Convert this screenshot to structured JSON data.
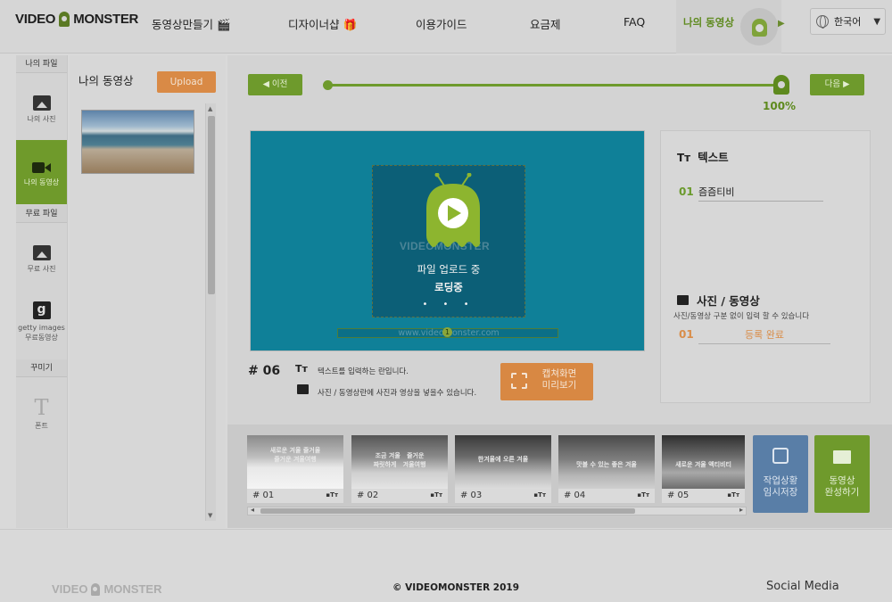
{
  "header": {
    "logo_left": "VIDEO",
    "logo_right": "MONSTER",
    "nav": [
      {
        "label": "동영상만들기 🎬"
      },
      {
        "label": "디자이너샵 🎁"
      },
      {
        "label": "이용가이드"
      },
      {
        "label": "요금제"
      },
      {
        "label": "FAQ"
      }
    ],
    "my_video": "나의 동영상",
    "language": "한국어"
  },
  "sidebar": {
    "my_files": "나의 파일",
    "my_photos": "나의 사진",
    "my_videos": "나의 동영상",
    "free_files": "무료 파일",
    "free_photos": "무료 사진",
    "getty_line1": "getty images",
    "getty_line2": "무료동영상",
    "decorate": "꾸미기",
    "font": "폰트"
  },
  "file_panel": {
    "title": "나의 동영상",
    "upload_label": "Upload"
  },
  "progress": {
    "prev_label": "◀ 이전",
    "next_label": "다음 ▶",
    "percent_text": "100%",
    "value": 1.0
  },
  "preview": {
    "watermark_logo": "VIDEOMONSTER",
    "uploading_text": "파일 업로드 중",
    "loading_text": "로딩중",
    "dots": "• • •",
    "watermark_url": "www.videomonster.com",
    "pin_number": "1"
  },
  "scene_info": {
    "scene_number": "# 06",
    "text_hint": "텍스트를 입력하는 란입니다.",
    "media_hint": "사진 / 동영상란에 사진과 영상을 넣을수 있습니다.",
    "capture_label_line1": "캡쳐화면",
    "capture_label_line2": "미리보기"
  },
  "right_panel": {
    "text_icon": "Tт",
    "text_heading": "텍스트",
    "text_index": "01",
    "text_value": "즘즘티비",
    "media_heading": "사진 / 동영상",
    "media_sub": "사진/동영상 구분 없이 입력 할 수 있습니다",
    "media_index": "01",
    "media_value": "등록 완료"
  },
  "timeline": {
    "scenes": [
      {
        "label": "# 01",
        "overlay": "새로운 겨울 즐거울\n즐거운 겨울여행"
      },
      {
        "label": "# 02",
        "overlay": "조금 겨울   즐거운\n짜릿하게   겨울여행"
      },
      {
        "label": "# 03",
        "overlay": "한겨울에 오른 겨울"
      },
      {
        "label": "# 04",
        "overlay": "맛볼 수 있는 좋은 겨울"
      },
      {
        "label": "# 05",
        "overlay": "새로운 겨울 액티비티"
      }
    ],
    "scene_icons": "▪Tт",
    "save_label_line1": "작업상황",
    "save_label_line2": "임시저장",
    "done_label_line1": "동영상",
    "done_label_line2": "완성하기"
  },
  "footer": {
    "logo_left": "VIDEO",
    "logo_right": "MONSTER",
    "copyright": "© VIDEOMONSTER 2019",
    "social": "Social Media"
  },
  "colors": {
    "green": "#6f9a2c",
    "orange": "#d98a46",
    "blue": "#597ea7",
    "preview_bg": "#0f8098"
  }
}
